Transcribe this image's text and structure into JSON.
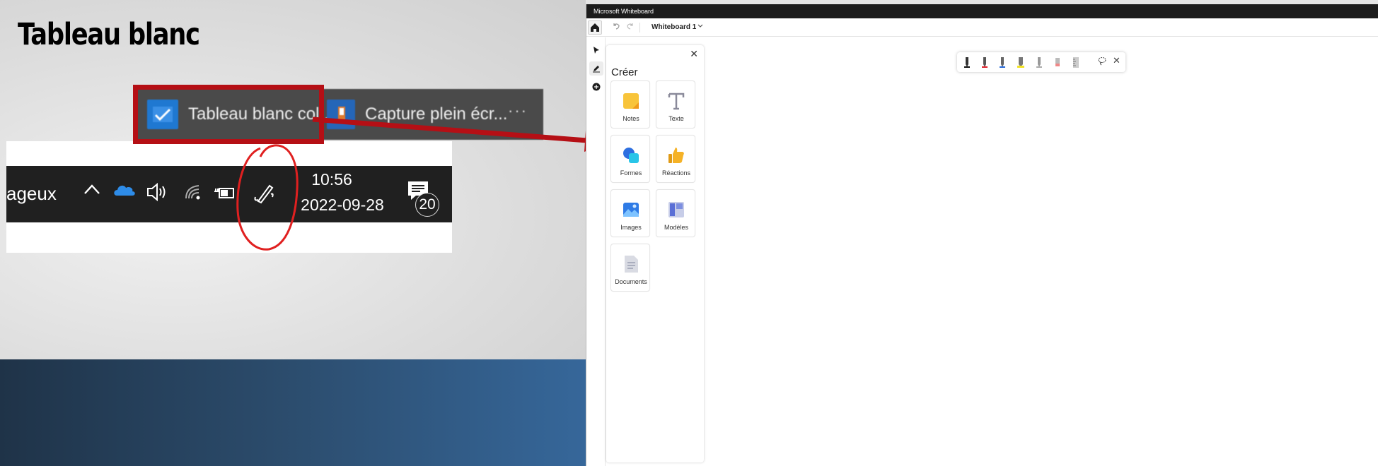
{
  "slide": {
    "title": "Tableau blanc",
    "popup": {
      "item1_label": "Tableau blanc col...",
      "item2_label": "Capture plein écr...",
      "more": "···"
    },
    "taskbar": {
      "partial_text": "ageux",
      "time": "10:56",
      "date": "2022-09-28",
      "notification_count": "20"
    },
    "annotation_color": "#b50f15"
  },
  "whiteboard": {
    "app_title": "Microsoft Whiteboard",
    "board_name": "Whiteboard 1",
    "panel": {
      "title": "Créer",
      "close": "✕",
      "tiles": [
        {
          "label": "Notes",
          "icon": "notes-icon"
        },
        {
          "label": "Texte",
          "icon": "text-icon"
        },
        {
          "label": "Formes",
          "icon": "shapes-icon"
        },
        {
          "label": "Réactions",
          "icon": "reactions-icon"
        },
        {
          "label": "Images",
          "icon": "images-icon"
        },
        {
          "label": "Modèles",
          "icon": "templates-icon"
        },
        {
          "label": "Documents",
          "icon": "documents-icon"
        }
      ]
    },
    "ink_toolbar": {
      "pens": [
        "black-pen",
        "red-pen",
        "blue-pen",
        "yellow-highlighter",
        "gray-pen",
        "eraser",
        "ruler"
      ],
      "close": "✕"
    }
  }
}
